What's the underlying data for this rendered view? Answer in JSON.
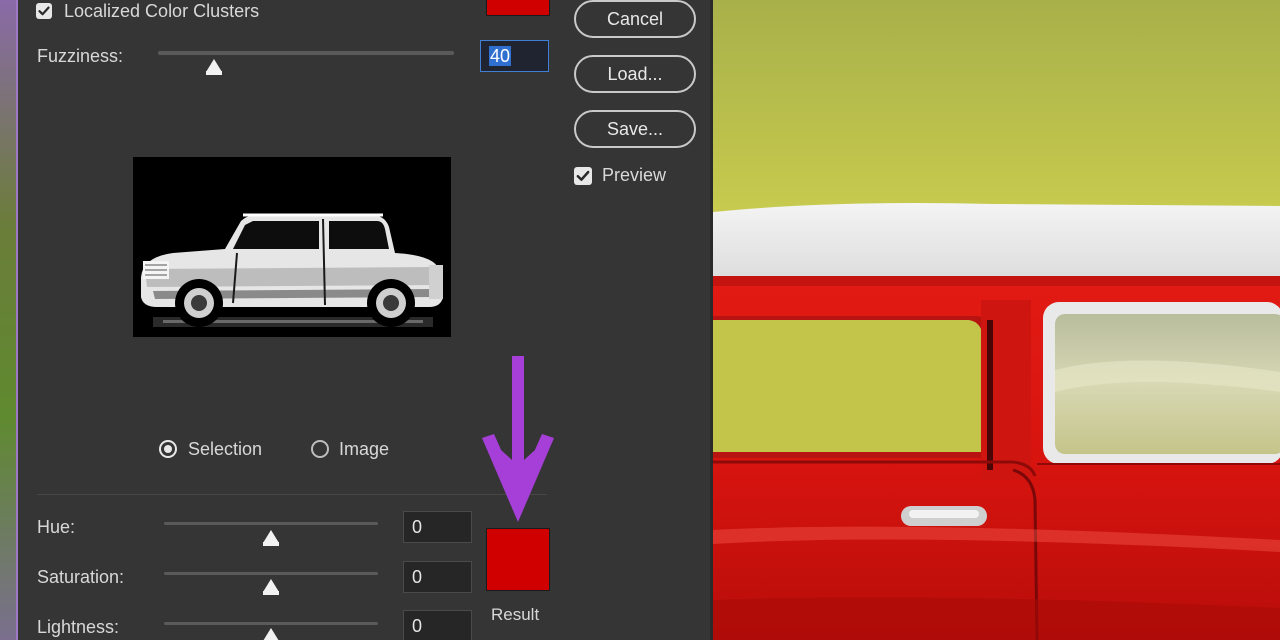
{
  "options": {
    "localized_label": "Localized Color Clusters",
    "localized_checked": true
  },
  "fuzziness": {
    "label": "Fuzziness:",
    "value": "40",
    "slider_fraction": 0.195
  },
  "buttons": {
    "cancel": "Cancel",
    "load": "Load...",
    "save": "Save..."
  },
  "preview": {
    "label": "Preview",
    "checked": true
  },
  "view_mode": {
    "selection_label": "Selection",
    "image_label": "Image",
    "selected": "Selection"
  },
  "adjustments": {
    "hue": {
      "label": "Hue:",
      "value": "0",
      "slider_fraction": 0.5
    },
    "saturation": {
      "label": "Saturation:",
      "value": "0",
      "slider_fraction": 0.5
    },
    "lightness": {
      "label": "Lightness:",
      "value": "0",
      "slider_fraction": 0.5
    }
  },
  "result": {
    "label": "Result",
    "color": "#d10000"
  },
  "colors": {
    "dialog_bg": "#353535",
    "accent_blue": "#3f7fd4",
    "annotation_arrow": "#a63fd8",
    "swatch_red": "#d10000"
  }
}
